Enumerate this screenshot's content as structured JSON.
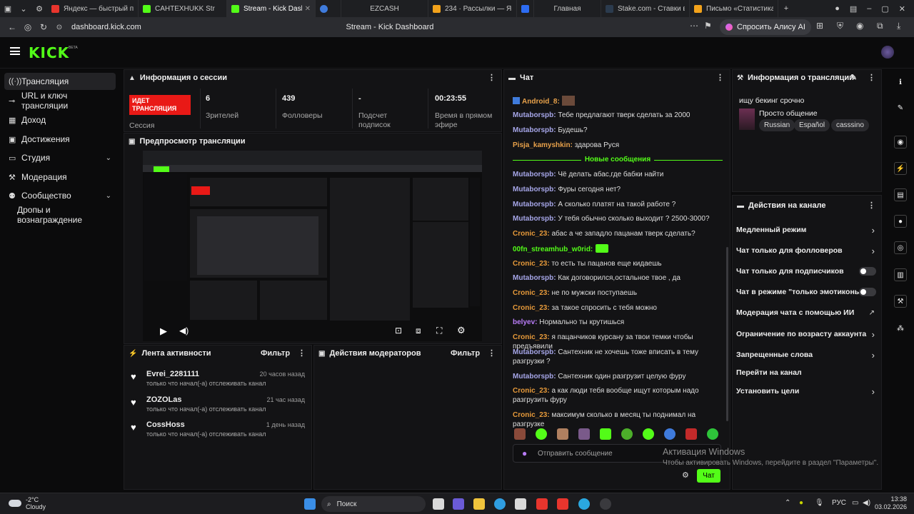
{
  "browser": {
    "tabs": [
      {
        "title": "Яндекс — быстрый пои",
        "color": "#e8352d"
      },
      {
        "title": "CAHTEXHUKK Str",
        "color": "#53fc18"
      },
      {
        "title": "Stream - Kick Dashb",
        "color": "#53fc18",
        "active": true
      },
      {
        "title": "",
        "color": "#3f7bdc"
      },
      {
        "title": "EZCASH",
        "color": ""
      },
      {
        "title": "234 · Рассылки — Янде",
        "color": "#f2a21b"
      },
      {
        "title": "",
        "color": "#2d6cf2"
      },
      {
        "title": "Главная",
        "color": ""
      },
      {
        "title": "Stake.com - Ставки в ка",
        "color": "#2b3b4e"
      },
      {
        "title": "Письмо «Статистика за",
        "color": "#f2a21b"
      }
    ],
    "url": "dashboard.kick.com",
    "page_title": "Stream - Kick Dashboard",
    "alice_label": "Спросить Алису AI"
  },
  "header": {
    "logo": "KICK",
    "beta": "BETA"
  },
  "sidebar": {
    "items": [
      {
        "label": "Трансляция",
        "icon": "broadcast-icon"
      },
      {
        "label": "URL и ключ трансляции",
        "icon": "key-icon"
      },
      {
        "label": "Доход",
        "icon": "income-icon"
      },
      {
        "label": "Достижения",
        "icon": "achievements-icon"
      },
      {
        "label": "Студия",
        "icon": "studio-icon"
      },
      {
        "label": "Модерация",
        "icon": "moderation-icon"
      },
      {
        "label": "Сообщество",
        "icon": "community-icon"
      },
      {
        "label": "Дропы и вознаграждение",
        "icon": ""
      }
    ]
  },
  "session": {
    "title": "Информация о сессии",
    "live_badge": "ИДЕТ ТРАНСЛЯЦИЯ",
    "session_label": "Сессия",
    "stats": [
      {
        "value": "6",
        "label": "Зрителей"
      },
      {
        "value": "439",
        "label": "Фолловеры"
      },
      {
        "value": "-",
        "label": "Подсчет подписок"
      },
      {
        "value": "00:23:55",
        "label": "Время в прямом эфире"
      }
    ]
  },
  "preview": {
    "title": "Предпросмотр трансляции"
  },
  "activity": {
    "title": "Лента активности",
    "filter": "Фильтр",
    "items": [
      {
        "name": "Evrei_2281111",
        "time": "20 часов назад",
        "desc": "только что начал(-а) отслеживать канал"
      },
      {
        "name": "ZOZOLas",
        "time": "21 час назад",
        "desc": "только что начал(-а) отслеживать канал"
      },
      {
        "name": "CossHoss",
        "time": "1 день назад",
        "desc": "только что начал(-а) отслеживать канал"
      }
    ]
  },
  "mod_actions": {
    "title": "Действия модераторов",
    "filter": "Фильтр"
  },
  "chat": {
    "title": "Чат",
    "top_user": "Android_8:",
    "new_messages": "Новые сообщения",
    "messages_before": [
      {
        "user": "Mutaborspb:",
        "text": " Тебе предлагают тверк сделать за 2000",
        "cls": "u-m"
      },
      {
        "user": "Mutaborspb:",
        "text": " Будешь?",
        "cls": "u-m"
      },
      {
        "user": "Pisja_kamyshkin:",
        "text": " здарова Руся",
        "cls": "u-p"
      }
    ],
    "messages_after": [
      {
        "user": "Mutaborspb:",
        "text": " Чё делать абас,где бабки найти",
        "cls": "u-m"
      },
      {
        "user": "Mutaborspb:",
        "text": " Фуры сегодня нет?",
        "cls": "u-m"
      },
      {
        "user": "Mutaborspb:",
        "text": " А сколько платят на такой работе ?",
        "cls": "u-m"
      },
      {
        "user": "Mutaborspb:",
        "text": " У тебя обычно сколько выходит ? 2500-3000?",
        "cls": "u-m"
      },
      {
        "user": "Cronic_23:",
        "text": " абас а че западло пацанам тверк сделать?",
        "cls": "u-c"
      },
      {
        "user": "00fn_streamhub_w0rid:",
        "text": "",
        "cls": "u-g"
      },
      {
        "user": "Cronic_23:",
        "text": " то есть ты пацанов еще кидаешь",
        "cls": "u-c"
      },
      {
        "user": "Mutaborspb:",
        "text": " Как договорился,остальное твое , да",
        "cls": "u-m"
      },
      {
        "user": "Cronic_23:",
        "text": " не по мужски поступаешь",
        "cls": "u-c"
      },
      {
        "user": "Cronic_23:",
        "text": " за такое спросить с тебя можно",
        "cls": "u-c"
      },
      {
        "user": "belyev:",
        "text": " Нормально ты крутишься",
        "cls": "u-b"
      },
      {
        "user": "Cronic_23:",
        "text": " я пацанчиков курсану за твои темки чтобы предъявили",
        "cls": "u-c"
      },
      {
        "user": "Mutaborspb:",
        "text": " Сантехник не хочешь тоже вписать в тему разгрузки ?",
        "cls": "u-m"
      },
      {
        "user": "Mutaborspb:",
        "text": " Сантехник один разгрузит целую фуру",
        "cls": "u-m"
      },
      {
        "user": "Cronic_23:",
        "text": " а как люди тебя вообще ищут которым надо разгрузить фуру",
        "cls": "u-c"
      },
      {
        "user": "Cronic_23:",
        "text": " максимум сколько в месяц ты поднимал на разгрузке",
        "cls": "u-c"
      }
    ],
    "input_placeholder": "Отправить сообщение",
    "send_label": "Чат"
  },
  "stream_info": {
    "title": "Информация о трансляции",
    "stream_title": "ищу бекинг срочно",
    "category": "Просто общение",
    "tags": [
      "Russian",
      "Español",
      "casssino"
    ]
  },
  "channel_actions": {
    "title": "Действия на канале",
    "items": [
      {
        "label": "Медленный режим",
        "kind": "arrow"
      },
      {
        "label": "Чат только для фолловеров",
        "kind": "arrow"
      },
      {
        "label": "Чат только для подписчиков",
        "kind": "toggle"
      },
      {
        "label": "Чат в режиме \"только эмотиконы\"",
        "kind": "toggle"
      },
      {
        "label": "Модерация чата с помощью ИИ",
        "kind": "external"
      },
      {
        "label": "Ограничение по возрасту аккаунта",
        "kind": "arrow"
      },
      {
        "label": "Запрещенные слова",
        "kind": "arrow"
      },
      {
        "label": "Перейти на канал",
        "kind": "none"
      },
      {
        "label": "Установить цели",
        "kind": "arrow"
      }
    ]
  },
  "watermark": {
    "line1": "Активация Windows",
    "line2": "Чтобы активировать Windows, перейдите в раздел \"Параметры\"."
  },
  "taskbar": {
    "weather_temp": "-2°C",
    "weather_text": "Cloudy",
    "search": "Поиск",
    "lang": "РУС",
    "time": "13:38",
    "date": "03.02.2026"
  }
}
